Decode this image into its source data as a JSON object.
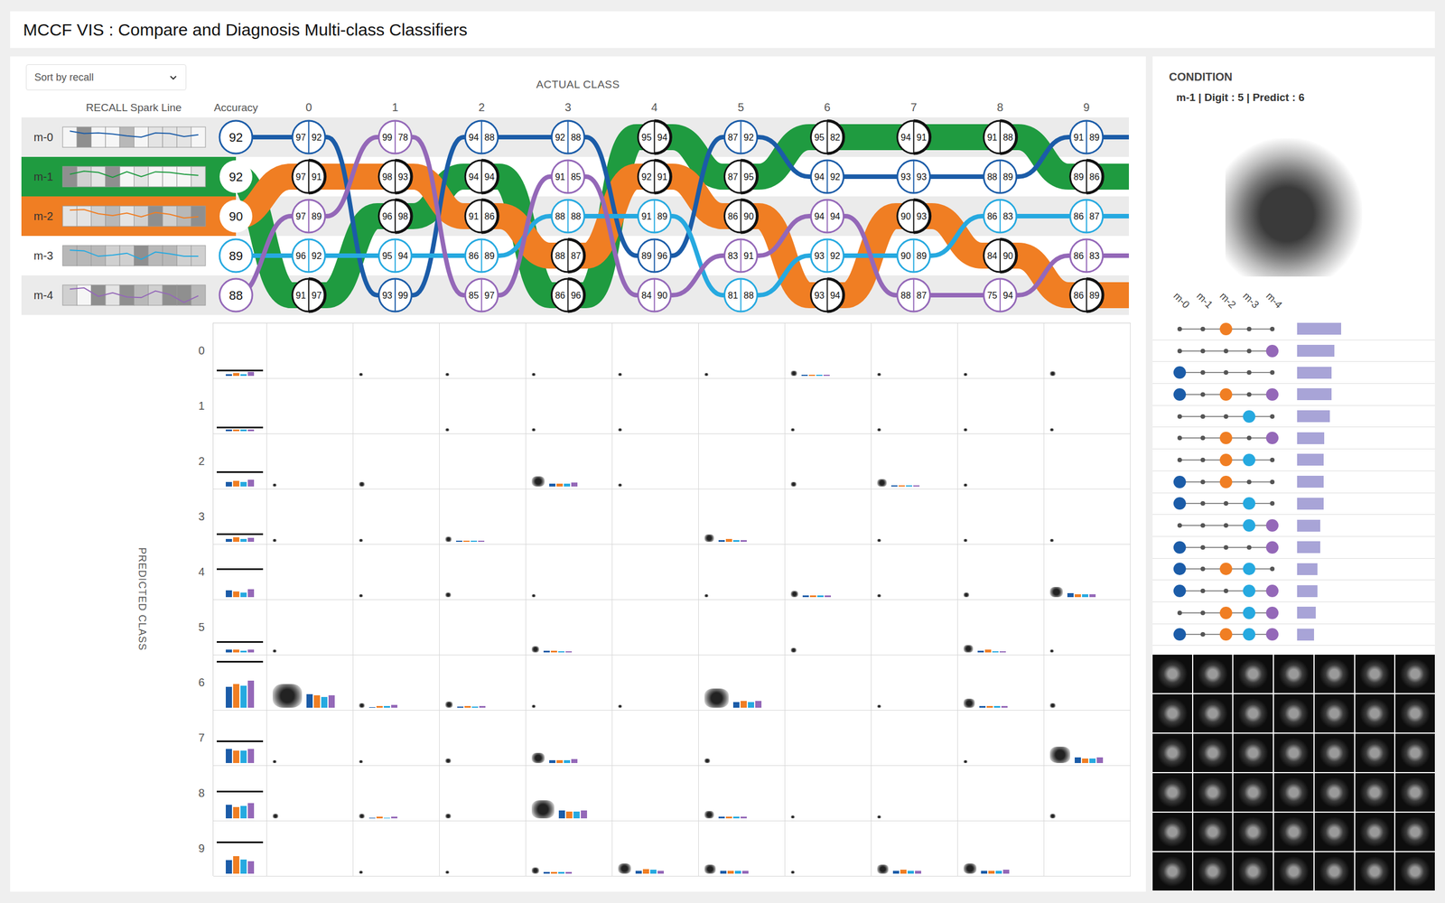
{
  "header": {
    "title": "MCCF VIS : Compare and Diagnosis Multi-class Classifiers"
  },
  "sort": {
    "label": "Sort by recall"
  },
  "actual_axis": {
    "label": "ACTUAL CLASS"
  },
  "columns": {
    "spark": "RECALL Spark Line",
    "accuracy": "Accuracy",
    "classes": [
      "0",
      "1",
      "2",
      "3",
      "4",
      "5",
      "6",
      "7",
      "8",
      "9"
    ]
  },
  "models": [
    {
      "name": "m-0",
      "accuracy": "92",
      "color": "#1b5ca8",
      "highlighted": false
    },
    {
      "name": "m-1",
      "accuracy": "92",
      "color": "#1f9b40",
      "highlighted": true
    },
    {
      "name": "m-2",
      "accuracy": "90",
      "color": "#f07e23",
      "highlighted": true
    },
    {
      "name": "m-3",
      "accuracy": "89",
      "color": "#26a9e0",
      "highlighted": false
    },
    {
      "name": "m-4",
      "accuracy": "88",
      "color": "#9468b8",
      "highlighted": false
    }
  ],
  "ranking": [
    [
      {
        "model": "m-0",
        "recall": "97",
        "precision": "92"
      },
      {
        "model": "m-2",
        "recall": "97",
        "precision": "91"
      },
      {
        "model": "m-4",
        "recall": "97",
        "precision": "89"
      },
      {
        "model": "m-3",
        "recall": "96",
        "precision": "92"
      },
      {
        "model": "m-1",
        "recall": "91",
        "precision": "97"
      }
    ],
    [
      {
        "model": "m-4",
        "recall": "99",
        "precision": "78"
      },
      {
        "model": "m-2",
        "recall": "98",
        "precision": "93"
      },
      {
        "model": "m-1",
        "recall": "96",
        "precision": "98"
      },
      {
        "model": "m-3",
        "recall": "95",
        "precision": "94"
      },
      {
        "model": "m-0",
        "recall": "93",
        "precision": "99"
      }
    ],
    [
      {
        "model": "m-0",
        "recall": "94",
        "precision": "88"
      },
      {
        "model": "m-1",
        "recall": "94",
        "precision": "94"
      },
      {
        "model": "m-2",
        "recall": "91",
        "precision": "86"
      },
      {
        "model": "m-3",
        "recall": "86",
        "precision": "89"
      },
      {
        "model": "m-4",
        "recall": "85",
        "precision": "97"
      }
    ],
    [
      {
        "model": "m-0",
        "recall": "92",
        "precision": "88"
      },
      {
        "model": "m-4",
        "recall": "91",
        "precision": "85"
      },
      {
        "model": "m-3",
        "recall": "88",
        "precision": "88"
      },
      {
        "model": "m-2",
        "recall": "88",
        "precision": "87"
      },
      {
        "model": "m-1",
        "recall": "86",
        "precision": "96"
      }
    ],
    [
      {
        "model": "m-1",
        "recall": "95",
        "precision": "94"
      },
      {
        "model": "m-2",
        "recall": "92",
        "precision": "91"
      },
      {
        "model": "m-3",
        "recall": "91",
        "precision": "89"
      },
      {
        "model": "m-0",
        "recall": "89",
        "precision": "96"
      },
      {
        "model": "m-4",
        "recall": "84",
        "precision": "90"
      }
    ],
    [
      {
        "model": "m-0",
        "recall": "87",
        "precision": "92"
      },
      {
        "model": "m-1",
        "recall": "87",
        "precision": "95"
      },
      {
        "model": "m-2",
        "recall": "86",
        "precision": "90"
      },
      {
        "model": "m-4",
        "recall": "83",
        "precision": "91"
      },
      {
        "model": "m-3",
        "recall": "81",
        "precision": "88"
      }
    ],
    [
      {
        "model": "m-1",
        "recall": "95",
        "precision": "82"
      },
      {
        "model": "m-0",
        "recall": "94",
        "precision": "92"
      },
      {
        "model": "m-4",
        "recall": "94",
        "precision": "94"
      },
      {
        "model": "m-3",
        "recall": "93",
        "precision": "92"
      },
      {
        "model": "m-2",
        "recall": "93",
        "precision": "94"
      }
    ],
    [
      {
        "model": "m-1",
        "recall": "94",
        "precision": "91"
      },
      {
        "model": "m-0",
        "recall": "93",
        "precision": "93"
      },
      {
        "model": "m-2",
        "recall": "90",
        "precision": "93"
      },
      {
        "model": "m-3",
        "recall": "90",
        "precision": "89"
      },
      {
        "model": "m-4",
        "recall": "88",
        "precision": "87"
      }
    ],
    [
      {
        "model": "m-1",
        "recall": "91",
        "precision": "88"
      },
      {
        "model": "m-0",
        "recall": "88",
        "precision": "89"
      },
      {
        "model": "m-3",
        "recall": "86",
        "precision": "83"
      },
      {
        "model": "m-2",
        "recall": "84",
        "precision": "90"
      },
      {
        "model": "m-4",
        "recall": "75",
        "precision": "94"
      }
    ],
    [
      {
        "model": "m-0",
        "recall": "91",
        "precision": "89"
      },
      {
        "model": "m-1",
        "recall": "89",
        "precision": "86"
      },
      {
        "model": "m-3",
        "recall": "86",
        "precision": "87"
      },
      {
        "model": "m-4",
        "recall": "86",
        "precision": "83"
      },
      {
        "model": "m-2",
        "recall": "86",
        "precision": "89"
      }
    ]
  ],
  "matrix": {
    "axis_label": "PREDICTED CLASS",
    "rows": [
      "0",
      "1",
      "2",
      "3",
      "4",
      "5",
      "6",
      "7",
      "8",
      "9"
    ],
    "bar_models": [
      "m-0",
      "m-2",
      "m-3",
      "m-4"
    ],
    "summary": [
      [
        2,
        3,
        2,
        4
      ],
      [
        2,
        2,
        2,
        2
      ],
      [
        5,
        6,
        5,
        7
      ],
      [
        3,
        5,
        3,
        4
      ],
      [
        7,
        6,
        5,
        8
      ],
      [
        3,
        3,
        2,
        3
      ],
      [
        22,
        25,
        23,
        28
      ],
      [
        15,
        13,
        13,
        15
      ],
      [
        14,
        12,
        13,
        16
      ],
      [
        14,
        18,
        15,
        13
      ]
    ],
    "reference": [
      5,
      3,
      14,
      7,
      28,
      10,
      47,
      22,
      27,
      32
    ],
    "cells": [
      {
        "row": 6,
        "col": 0,
        "thumb": 0.95,
        "bars": [
          14,
          13,
          11,
          13
        ]
      },
      {
        "row": 6,
        "col": 5,
        "thumb": 0.78,
        "bars": [
          6,
          7,
          6,
          7
        ]
      },
      {
        "row": 8,
        "col": 3,
        "thumb": 0.72,
        "bars": [
          8,
          7,
          7,
          8
        ]
      },
      {
        "row": 7,
        "col": 9,
        "thumb": 0.66,
        "bars": [
          6,
          5,
          5,
          6
        ]
      },
      {
        "row": 9,
        "col": 4,
        "thumb": 0.42,
        "bars": [
          3,
          5,
          4,
          3
        ]
      },
      {
        "row": 9,
        "col": 5,
        "thumb": 0.36,
        "bars": [
          3,
          3,
          3,
          3
        ]
      },
      {
        "row": 9,
        "col": 7,
        "thumb": 0.36,
        "bars": [
          3,
          4,
          3,
          3
        ]
      },
      {
        "row": 9,
        "col": 8,
        "thumb": 0.42,
        "bars": [
          3,
          3,
          3,
          4
        ]
      },
      {
        "row": 2,
        "col": 3,
        "thumb": 0.42,
        "bars": [
          3,
          3,
          3,
          4
        ]
      },
      {
        "row": 7,
        "col": 3,
        "thumb": 0.42,
        "bars": [
          3,
          3,
          3,
          4
        ]
      },
      {
        "row": 4,
        "col": 9,
        "thumb": 0.42,
        "bars": [
          4,
          3,
          3,
          3
        ]
      },
      {
        "row": 3,
        "col": 5,
        "thumb": 0.3,
        "bars": [
          2,
          3,
          2,
          2
        ]
      },
      {
        "row": 5,
        "col": 8,
        "thumb": 0.3,
        "bars": [
          2,
          3,
          1,
          1
        ]
      },
      {
        "row": 4,
        "col": 6,
        "thumb": 0.24,
        "bars": [
          2,
          2,
          2,
          2
        ]
      },
      {
        "row": 6,
        "col": 8,
        "thumb": 0.36,
        "bars": [
          2,
          2,
          2,
          2
        ]
      },
      {
        "row": 5,
        "col": 3,
        "thumb": 0.24,
        "bars": [
          2,
          2,
          1,
          1
        ]
      },
      {
        "row": 9,
        "col": 3,
        "thumb": 0.24,
        "bars": [
          2,
          2,
          2,
          2
        ]
      },
      {
        "row": 8,
        "col": 5,
        "thumb": 0.3,
        "bars": [
          2,
          2,
          2,
          2
        ]
      },
      {
        "row": 6,
        "col": 1,
        "thumb": 0.18,
        "bars": [
          0,
          2,
          2,
          3
        ]
      },
      {
        "row": 6,
        "col": 2,
        "thumb": 0.24,
        "bars": [
          1,
          2,
          1,
          2
        ]
      },
      {
        "row": 8,
        "col": 1,
        "thumb": 0.18,
        "bars": [
          0,
          2,
          0,
          2
        ]
      },
      {
        "row": 2,
        "col": 7,
        "thumb": 0.3,
        "bars": [
          1,
          1,
          1,
          1
        ]
      },
      {
        "row": 0,
        "col": 6,
        "thumb": 0.2,
        "bars": [
          1,
          1,
          1,
          1
        ]
      },
      {
        "row": 3,
        "col": 2,
        "thumb": 0.2,
        "bars": [
          1,
          1,
          1,
          1
        ]
      },
      {
        "row": 0,
        "col": 1,
        "thumb": 0.12
      },
      {
        "row": 0,
        "col": 2,
        "thumb": 0.12
      },
      {
        "row": 0,
        "col": 3,
        "thumb": 0.12
      },
      {
        "row": 0,
        "col": 4,
        "thumb": 0.12
      },
      {
        "row": 0,
        "col": 5,
        "thumb": 0.12
      },
      {
        "row": 0,
        "col": 7,
        "thumb": 0.12
      },
      {
        "row": 0,
        "col": 8,
        "thumb": 0.12
      },
      {
        "row": 0,
        "col": 9,
        "thumb": 0.18
      },
      {
        "row": 1,
        "col": 2,
        "thumb": 0.12
      },
      {
        "row": 1,
        "col": 3,
        "thumb": 0.12
      },
      {
        "row": 1,
        "col": 4,
        "thumb": 0.12
      },
      {
        "row": 1,
        "col": 6,
        "thumb": 0.12
      },
      {
        "row": 1,
        "col": 7,
        "thumb": 0.12
      },
      {
        "row": 1,
        "col": 8,
        "thumb": 0.12
      },
      {
        "row": 1,
        "col": 9,
        "thumb": 0.12
      },
      {
        "row": 2,
        "col": 0,
        "thumb": 0.12
      },
      {
        "row": 2,
        "col": 1,
        "thumb": 0.18
      },
      {
        "row": 2,
        "col": 4,
        "thumb": 0.12
      },
      {
        "row": 2,
        "col": 6,
        "thumb": 0.18
      },
      {
        "row": 2,
        "col": 8,
        "thumb": 0.12
      },
      {
        "row": 3,
        "col": 0,
        "thumb": 0.12
      },
      {
        "row": 3,
        "col": 1,
        "thumb": 0.12
      },
      {
        "row": 3,
        "col": 7,
        "thumb": 0.12
      },
      {
        "row": 3,
        "col": 8,
        "thumb": 0.12
      },
      {
        "row": 3,
        "col": 9,
        "thumb": 0.12
      },
      {
        "row": 4,
        "col": 1,
        "thumb": 0.12
      },
      {
        "row": 4,
        "col": 2,
        "thumb": 0.18
      },
      {
        "row": 4,
        "col": 3,
        "thumb": 0.12
      },
      {
        "row": 4,
        "col": 5,
        "thumb": 0.12
      },
      {
        "row": 4,
        "col": 7,
        "thumb": 0.12
      },
      {
        "row": 4,
        "col": 8,
        "thumb": 0.18
      },
      {
        "row": 5,
        "col": 0,
        "thumb": 0.12
      },
      {
        "row": 5,
        "col": 6,
        "thumb": 0.18
      },
      {
        "row": 5,
        "col": 9,
        "thumb": 0.12
      },
      {
        "row": 6,
        "col": 3,
        "thumb": 0.12
      },
      {
        "row": 6,
        "col": 4,
        "thumb": 0.12
      },
      {
        "row": 6,
        "col": 7,
        "thumb": 0.12
      },
      {
        "row": 6,
        "col": 9,
        "thumb": 0.18
      },
      {
        "row": 7,
        "col": 0,
        "thumb": 0.12
      },
      {
        "row": 7,
        "col": 1,
        "thumb": 0.12
      },
      {
        "row": 7,
        "col": 2,
        "thumb": 0.18
      },
      {
        "row": 7,
        "col": 5,
        "thumb": 0.18
      },
      {
        "row": 7,
        "col": 8,
        "thumb": 0.12
      },
      {
        "row": 8,
        "col": 0,
        "thumb": 0.18
      },
      {
        "row": 8,
        "col": 2,
        "thumb": 0.18
      },
      {
        "row": 8,
        "col": 6,
        "thumb": 0.12
      },
      {
        "row": 8,
        "col": 7,
        "thumb": 0.12
      },
      {
        "row": 8,
        "col": 9,
        "thumb": 0.18
      },
      {
        "row": 9,
        "col": 1,
        "thumb": 0.12
      },
      {
        "row": 9,
        "col": 2,
        "thumb": 0.12
      },
      {
        "row": 9,
        "col": 6,
        "thumb": 0.12
      }
    ]
  },
  "condition": {
    "title": "CONDITION",
    "text": "m-1 | Digit : 5 | Predict : 6"
  },
  "combinations": {
    "labels": [
      "m-0",
      "m-1",
      "m-2",
      "m-3",
      "m-4"
    ],
    "rows": [
      {
        "members": [
          false,
          false,
          true,
          false,
          false
        ],
        "level": 1.0
      },
      {
        "members": [
          false,
          false,
          false,
          false,
          true
        ],
        "level": 0.85
      },
      {
        "members": [
          true,
          false,
          false,
          false,
          false
        ],
        "level": 0.78
      },
      {
        "members": [
          true,
          false,
          true,
          false,
          true
        ],
        "level": 0.78
      },
      {
        "members": [
          false,
          false,
          false,
          true,
          false
        ],
        "level": 0.74
      },
      {
        "members": [
          false,
          false,
          true,
          false,
          true
        ],
        "level": 0.62
      },
      {
        "members": [
          false,
          false,
          true,
          true,
          false
        ],
        "level": 0.6
      },
      {
        "members": [
          true,
          false,
          true,
          false,
          false
        ],
        "level": 0.6
      },
      {
        "members": [
          true,
          false,
          false,
          true,
          false
        ],
        "level": 0.6
      },
      {
        "members": [
          false,
          false,
          false,
          true,
          true
        ],
        "level": 0.52
      },
      {
        "members": [
          true,
          false,
          false,
          false,
          true
        ],
        "level": 0.52
      },
      {
        "members": [
          true,
          false,
          true,
          true,
          false
        ],
        "level": 0.46
      },
      {
        "members": [
          true,
          false,
          false,
          true,
          true
        ],
        "level": 0.46
      },
      {
        "members": [
          false,
          false,
          true,
          true,
          true
        ],
        "level": 0.42
      },
      {
        "members": [
          true,
          false,
          true,
          true,
          true
        ],
        "level": 0.38
      }
    ]
  },
  "samples": {
    "count": 42
  }
}
